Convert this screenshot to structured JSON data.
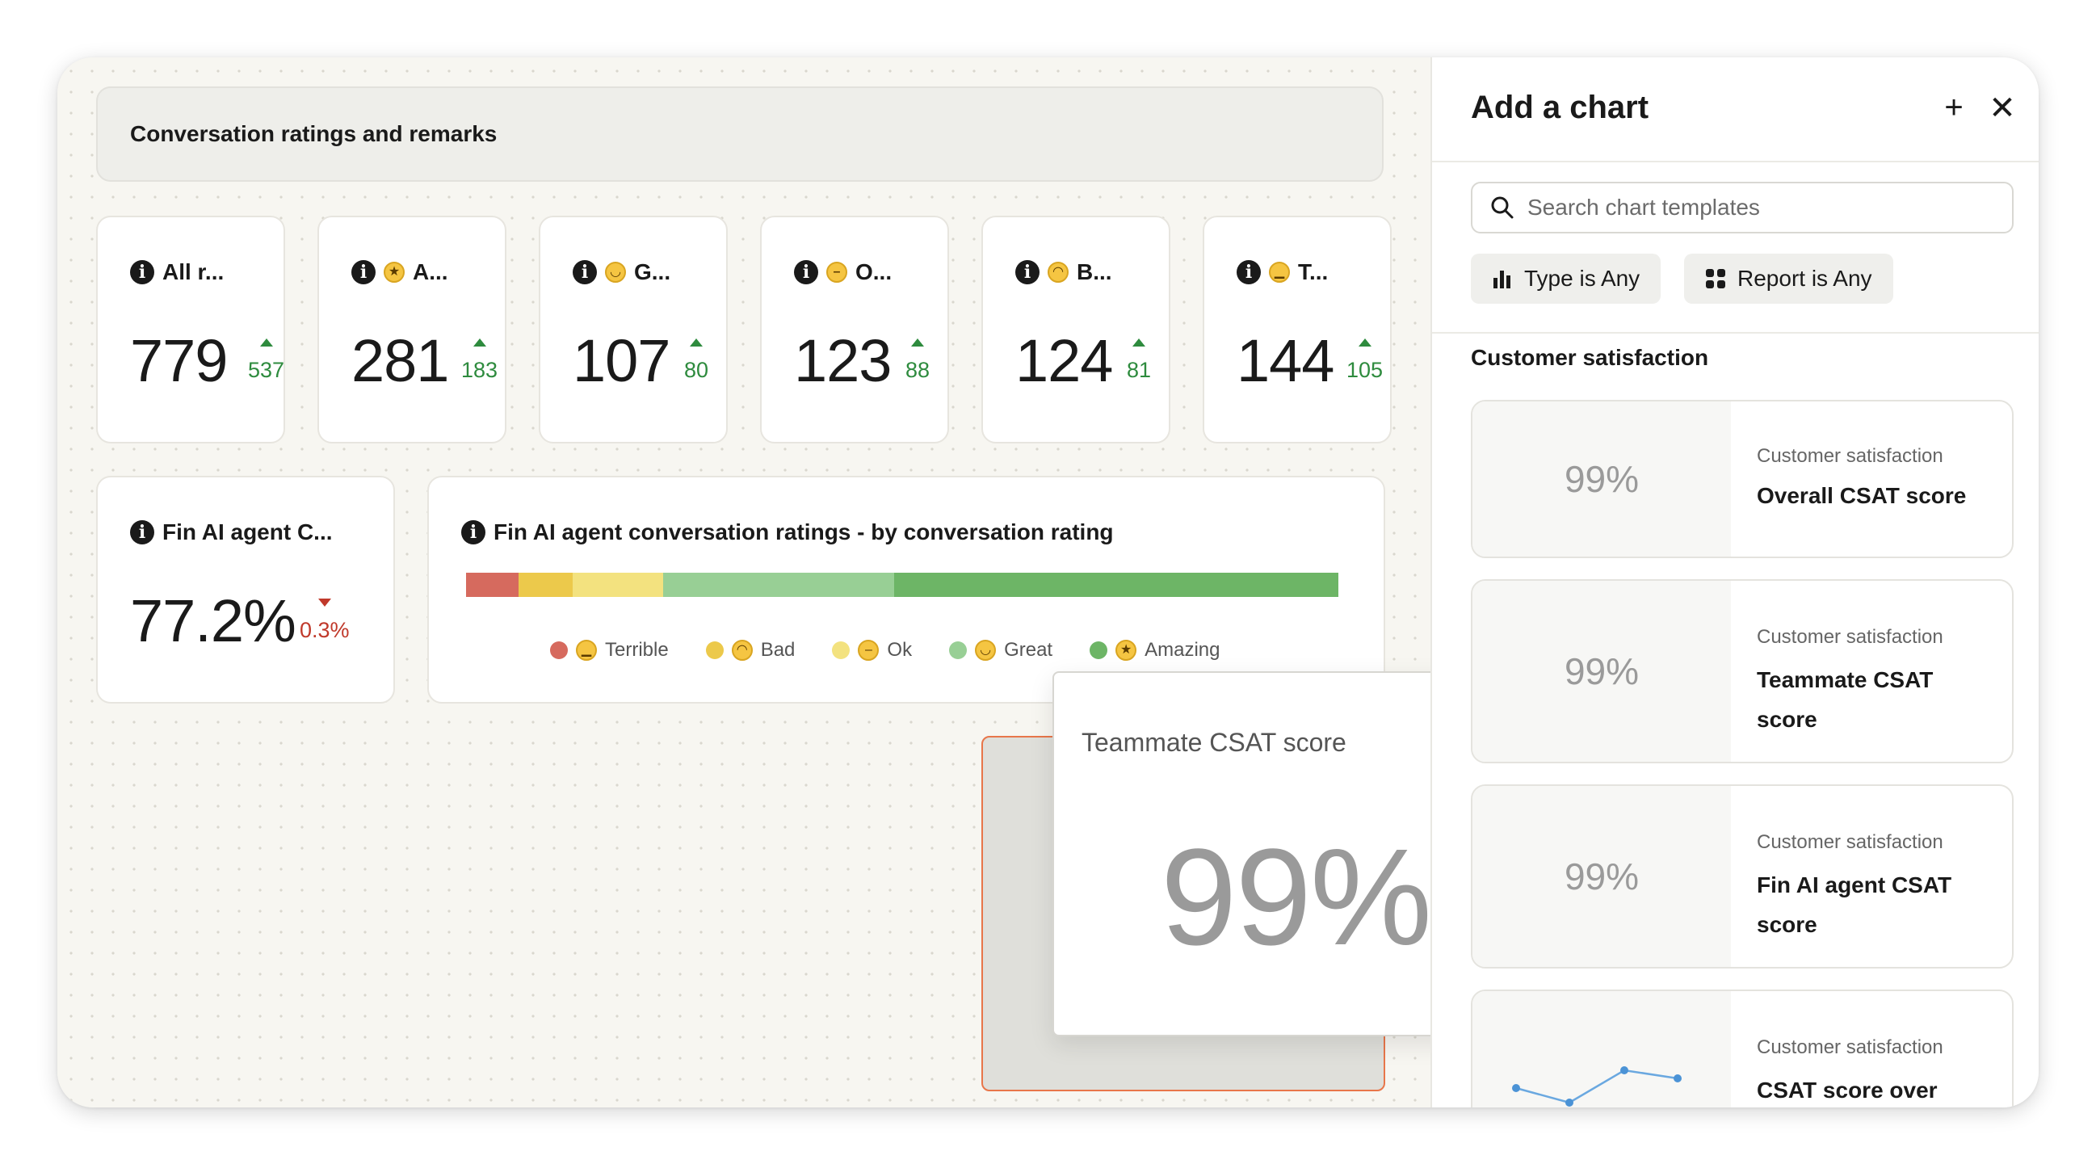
{
  "dashboard": {
    "header_title": "Conversation ratings and remarks",
    "stat_cards": [
      {
        "label": "All r...",
        "emoji": "",
        "value": "779",
        "delta": "537",
        "trend": "up"
      },
      {
        "label": "A...",
        "emoji": "🤩",
        "value": "281",
        "delta": "183",
        "trend": "up"
      },
      {
        "label": "G...",
        "emoji": "😃",
        "value": "107",
        "delta": "80",
        "trend": "up"
      },
      {
        "label": "O...",
        "emoji": "😐",
        "value": "123",
        "delta": "88",
        "trend": "up"
      },
      {
        "label": "B...",
        "emoji": "🙁",
        "value": "124",
        "delta": "81",
        "trend": "up"
      },
      {
        "label": "T...",
        "emoji": "😠",
        "value": "144",
        "delta": "105",
        "trend": "up"
      }
    ],
    "fin_card": {
      "label": "Fin AI agent C...",
      "value": "77.2%",
      "delta": "0.3%",
      "trend": "down"
    },
    "ratings_chart": {
      "title": "Fin AI agent conversation ratings - by conversation rating",
      "segments": [
        {
          "name": "Terrible",
          "emoji": "😠",
          "fraction": 0.06,
          "color": "#d66a5e"
        },
        {
          "name": "Bad",
          "emoji": "🙁",
          "fraction": 0.062,
          "color": "#ecc94b"
        },
        {
          "name": "Ok",
          "emoji": "😐",
          "fraction": 0.104,
          "color": "#f3e27f"
        },
        {
          "name": "Great",
          "emoji": "😃",
          "fraction": 0.265,
          "color": "#98cf95"
        },
        {
          "name": "Amazing",
          "emoji": "🤩",
          "fraction": 0.509,
          "color": "#6db566"
        }
      ]
    },
    "drag_preview": {
      "title": "Teammate CSAT score",
      "value": "99%"
    }
  },
  "panel": {
    "title": "Add a chart",
    "add_icon": "plus-icon",
    "close_icon": "close-icon",
    "search_placeholder": "Search chart templates",
    "filters": [
      {
        "label": "Type is Any",
        "icon": "bar-chart-icon"
      },
      {
        "label": "Report is Any",
        "icon": "grid-icon"
      }
    ],
    "section": "Customer satisfaction",
    "templates": [
      {
        "category": "Customer satisfaction",
        "name": "Overall CSAT score",
        "preview": "99%"
      },
      {
        "category": "Customer satisfaction",
        "name": "Teammate CSAT score",
        "preview": "99%"
      },
      {
        "category": "Customer satisfaction",
        "name": "Fin AI agent CSAT score",
        "preview": "99%"
      },
      {
        "category": "Customer satisfaction",
        "name": "CSAT score over",
        "preview": ""
      }
    ]
  }
}
